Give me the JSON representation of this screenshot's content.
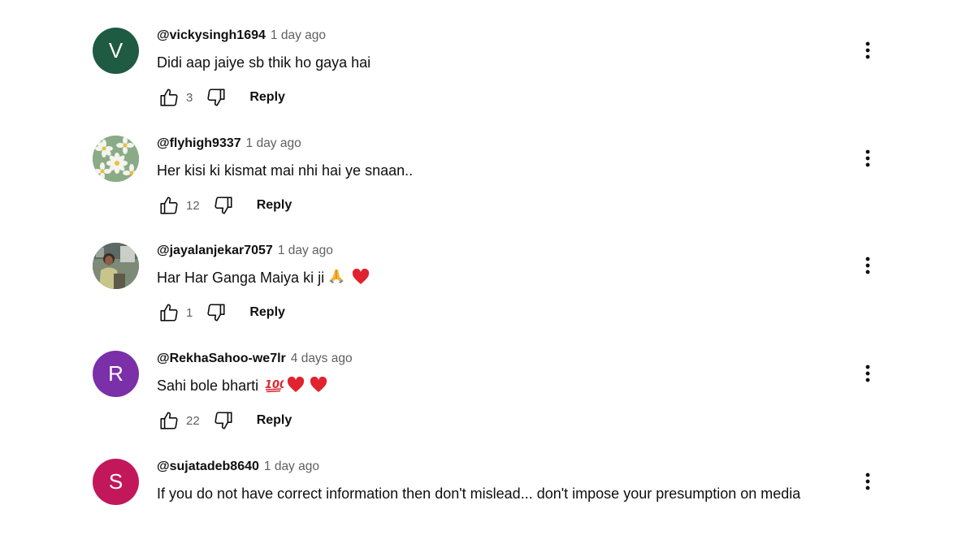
{
  "comments": [
    {
      "author": "@vickysingh1694",
      "time": "1 day ago",
      "text": "Didi aap jaiye sb thik ho gaya hai",
      "likes": "3",
      "reply_label": "Reply",
      "avatar": {
        "initial": "V",
        "color": "#1f5a43"
      }
    },
    {
      "author": "@flyhigh9337",
      "time": "1 day ago",
      "text": "Her kisi ki kismat mai nhi hai ye snaan..",
      "likes": "12",
      "reply_label": "Reply",
      "avatar": {
        "icon": "daisy-flowers-avatar",
        "color": "#8aab86"
      }
    },
    {
      "author": "@jayalanjekar7057",
      "time": "1 day ago",
      "text": "Har Har Ganga Maiya ki ji",
      "emojis": [
        "folded-hands",
        "red-heart"
      ],
      "likes": "1",
      "reply_label": "Reply",
      "avatar": {
        "icon": "person-photo-avatar",
        "color": "#6a7c63"
      }
    },
    {
      "author": "@RekhaSahoo-we7lr",
      "time": "4 days ago",
      "text": "Sahi bole bharti",
      "emojis": [
        "hundred-points",
        "red-heart",
        "red-heart"
      ],
      "likes": "22",
      "reply_label": "Reply",
      "avatar": {
        "initial": "R",
        "color": "#7b2fa8"
      }
    },
    {
      "author": "@sujatadeb8640",
      "time": "1 day ago",
      "text": "If you do not have correct information then don't mislead... don't impose your presumption on media",
      "avatar": {
        "initial": "S",
        "color": "#c2185b"
      }
    }
  ]
}
